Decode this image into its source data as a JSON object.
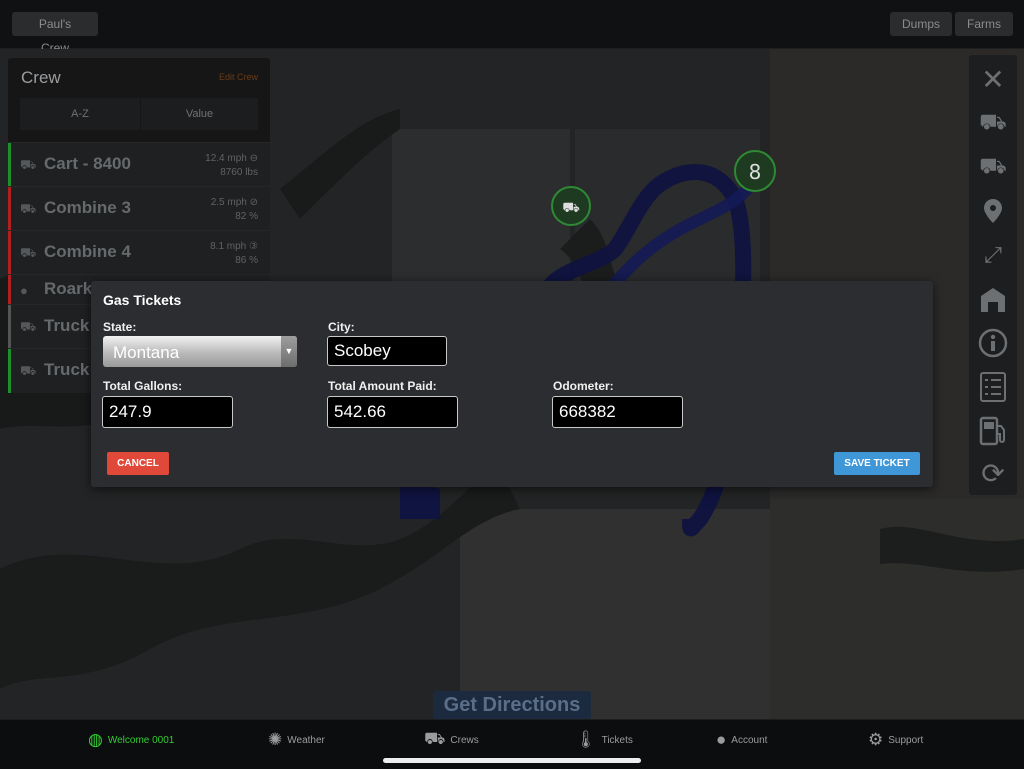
{
  "topbar": {
    "crew_button": "Paul's Crew",
    "dumps": "Dumps",
    "farms": "Farms"
  },
  "crew_panel": {
    "title": "Crew",
    "edit_label": "Edit Crew",
    "sort": {
      "az": "A-Z",
      "value": "Value"
    },
    "rows": [
      {
        "name": "Cart - 8400",
        "line1": "12.4 mph ⊖",
        "line2": "8760 lbs",
        "status_color": "#1e8f2a",
        "icon": "tractor-icon"
      },
      {
        "name": "Combine 3",
        "line1": "2.5 mph ⊘",
        "line2": "82 %",
        "status_color": "#b02020",
        "icon": "combine-icon"
      },
      {
        "name": "Combine 4",
        "line1": "8.1 mph ③",
        "line2": "86 %",
        "status_color": "#b02020",
        "icon": "combine-icon"
      },
      {
        "name": "Roark",
        "line1": "",
        "line2": "",
        "status_color": "#b02020",
        "icon": "person-icon"
      },
      {
        "name": "Truck",
        "line1": "",
        "line2": "",
        "status_color": "#555555",
        "icon": "truck-icon"
      },
      {
        "name": "Truck",
        "line1": "",
        "line2": "",
        "status_color": "#1e8f2a",
        "icon": "truck-icon"
      }
    ]
  },
  "toolbar": {
    "items": [
      "close-icon",
      "tractor-icon",
      "combine-icon",
      "location-pin-icon",
      "expand-icon",
      "barn-icon",
      "info-icon",
      "checklist-icon",
      "fuel-pump-icon",
      "refresh-icon"
    ]
  },
  "map": {
    "marker_1": "8"
  },
  "modal": {
    "title": "Gas Tickets",
    "state_label": "State:",
    "state_value": "Montana",
    "city_label": "City:",
    "city_value": "Scobey",
    "gallons_label": "Total Gallons:",
    "gallons_value": "247.9",
    "amount_label": "Total Amount Paid:",
    "amount_value": "542.66",
    "odometer_label": "Odometer:",
    "odometer_value": "668382",
    "cancel_label": "CANCEL",
    "save_label": "SAVE TICKET",
    "colors": {
      "cancel": "#e0483a",
      "save": "#3f97d8"
    }
  },
  "get_directions": "Get Directions",
  "tabbar": {
    "tabs": [
      {
        "label": "Welcome 0001",
        "icon": "globe-icon",
        "active": true,
        "color": "#33cc33"
      },
      {
        "label": "Weather",
        "icon": "sun-icon"
      },
      {
        "label": "Crews",
        "icon": "tractor-icon"
      },
      {
        "label": "Tickets",
        "icon": "thermometer-icon"
      },
      {
        "label": "Account",
        "icon": "person-icon"
      },
      {
        "label": "Support",
        "icon": "gears-icon"
      }
    ]
  }
}
